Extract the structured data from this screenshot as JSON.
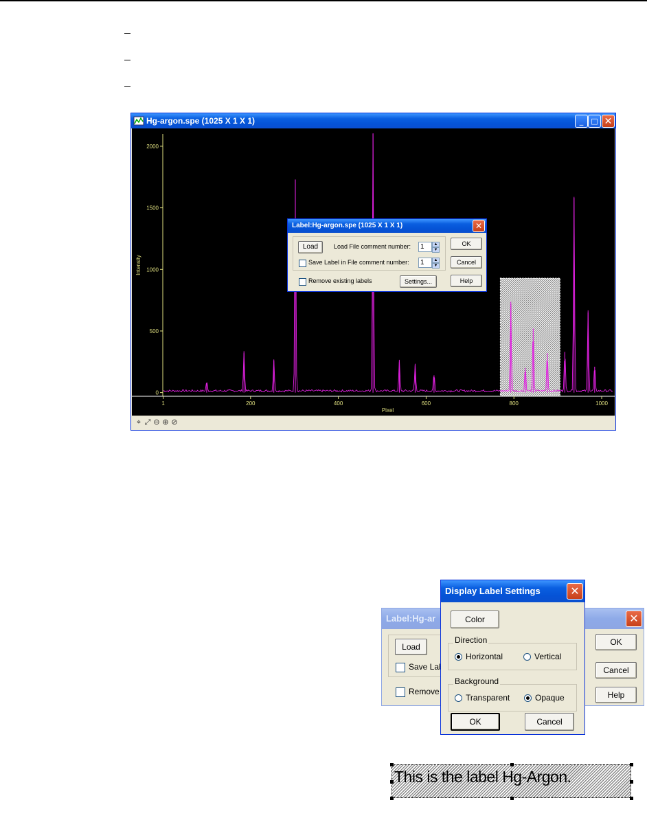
{
  "main_window": {
    "title": "Hg-argon.spe (1025 X 1 X 1)",
    "minimize_glyph": "_",
    "maximize_glyph": "□",
    "close_glyph": "✕"
  },
  "colors": {
    "plot_background": "#000000",
    "axis": "#e0e080",
    "trace": "#e020e0",
    "titlebar": "#0a5fe0"
  },
  "chart_data": {
    "type": "line",
    "xlabel": "Pixel",
    "ylabel": "Intensity",
    "xlim": [
      0,
      1025
    ],
    "ylim": [
      -30,
      2100
    ],
    "x_ticks": [
      "1",
      "200",
      "400",
      "600",
      "800",
      "1000"
    ],
    "y_ticks": [
      "0",
      "500",
      "1000",
      "1500",
      "2000"
    ],
    "peaks": [
      {
        "x": 100,
        "y": 80
      },
      {
        "x": 185,
        "y": 320
      },
      {
        "x": 253,
        "y": 260
      },
      {
        "x": 302,
        "y": 1730
      },
      {
        "x": 479,
        "y": 2100
      },
      {
        "x": 539,
        "y": 250
      },
      {
        "x": 575,
        "y": 220
      },
      {
        "x": 618,
        "y": 140
      },
      {
        "x": 793,
        "y": 720
      },
      {
        "x": 826,
        "y": 200
      },
      {
        "x": 844,
        "y": 520
      },
      {
        "x": 876,
        "y": 320
      },
      {
        "x": 916,
        "y": 330
      },
      {
        "x": 937,
        "y": 1580
      },
      {
        "x": 969,
        "y": 650
      },
      {
        "x": 984,
        "y": 210
      }
    ],
    "selection_region": [
      769,
      905
    ]
  },
  "toolbar": {
    "icons": [
      "cursor-icon",
      "autoscale-icon",
      "zoom-out-icon",
      "zoom-in-icon",
      "zoom-reset-icon"
    ]
  },
  "label_dialog": {
    "title": "Label:Hg-argon.spe (1025 X 1 X 1)",
    "load_label": "Load",
    "load_comment_label": "Load File comment number:",
    "load_comment_value": "1",
    "save_label_text": "Save Label in File comment number:",
    "save_comment_value": "1",
    "remove_label": "Remove existing labels",
    "settings_label": "Settings...",
    "ok_label": "OK",
    "cancel_label": "Cancel",
    "help_label": "Help"
  },
  "label_dialog_zoom": {
    "title": "Label:Hg-ar",
    "load_label": "Load",
    "save_partial": "Save Lab",
    "remove_partial": "Remove",
    "ok_label": "OK",
    "cancel_label": "Cancel",
    "help_label": "Help"
  },
  "settings_dialog": {
    "title": "Display Label Settings",
    "color_label": "Color",
    "direction_label": "Direction",
    "horizontal_label": "Horizontal",
    "vertical_label": "Vertical",
    "direction_selected": "Horizontal",
    "background_label": "Background",
    "transparent_label": "Transparent",
    "opaque_label": "Opaque",
    "background_selected": "Opaque",
    "ok_label": "OK",
    "cancel_label": "Cancel"
  },
  "label_sample": {
    "text": "This is the label Hg-Argon."
  }
}
